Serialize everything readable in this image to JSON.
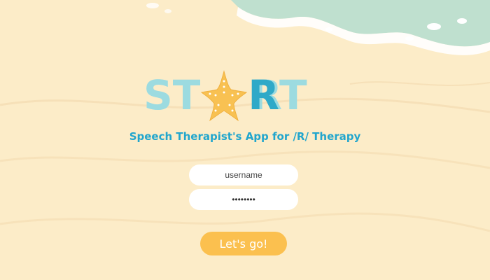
{
  "logo": {
    "letters": [
      "S",
      "T",
      "R",
      "T"
    ],
    "star_icon": "starfish-icon"
  },
  "subtitle": "Speech Therapist's App for /R/ Therapy",
  "login": {
    "username_placeholder": "username",
    "password_value": "xxxxxxxx",
    "submit_label": "Let's go!"
  },
  "colors": {
    "sand": "#fcecc8",
    "sea_foam": "#bfe0cf",
    "logo_light": "#9cdbe0",
    "logo_dark": "#2fa9c8",
    "subtitle": "#22a6cd",
    "button": "#fbc04f",
    "starfish": "#f8c152"
  }
}
